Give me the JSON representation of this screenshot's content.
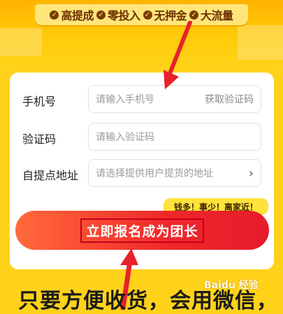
{
  "perks": [
    {
      "label": "高提成"
    },
    {
      "label": "零投入"
    },
    {
      "label": "无押金"
    },
    {
      "label": "大流量"
    }
  ],
  "form": {
    "phone_label": "手机号",
    "phone_placeholder": "请输入手机号",
    "get_code_label": "获取验证码",
    "code_label": "验证码",
    "code_placeholder": "请输入验证码",
    "pickup_label": "自提点地址",
    "pickup_placeholder": "请选择提供用户提货的地址"
  },
  "tagline": "钱多！事少！离家近！",
  "cta_label": "立即报名成为团长",
  "bottom_headline": "只要方便收货，会用微信，",
  "watermark": "Baidu 经验",
  "colors": {
    "background": "#ffd21a",
    "cta": "#f0282b",
    "arrow": "#e8222b",
    "perk_text": "#6b2f00"
  },
  "icons": {
    "perk": "check-circle-icon",
    "pickup_field": "chevron-right-icon"
  }
}
